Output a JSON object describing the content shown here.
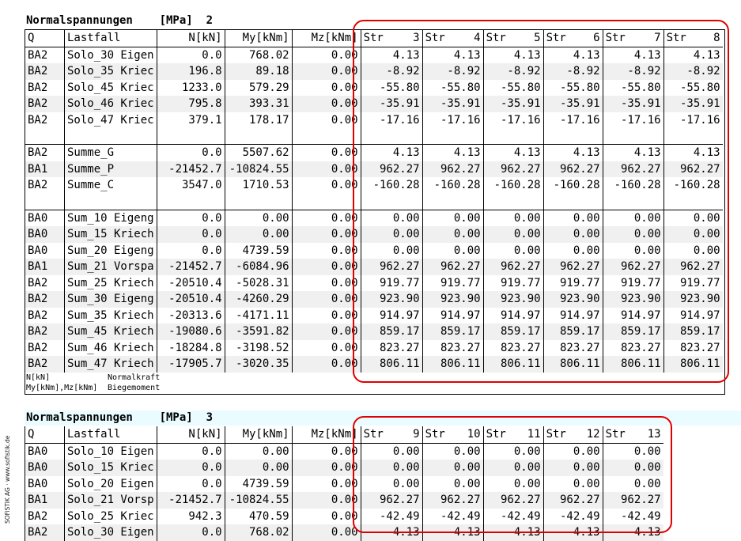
{
  "sidebar_text": "SOFiSTiK AG · www.sofistik.de",
  "section1": {
    "title": "Normalspannungen",
    "unit": "[MPa]",
    "number": "2",
    "columns": {
      "q": "Q",
      "lastfall": "Lastfall",
      "n": "N[kN]",
      "my": "My[kNm]",
      "mz": "Mz[kNm]",
      "str_label": "Str",
      "str_nums": [
        "3",
        "4",
        "5",
        "6",
        "7",
        "8"
      ]
    },
    "groups": [
      [
        {
          "q": "BA2",
          "lf": "Solo_30 Eigen",
          "n": "0.0",
          "my": "768.02",
          "mz": "0.00",
          "s": [
            "4.13",
            "4.13",
            "4.13",
            "4.13",
            "4.13",
            "4.13"
          ]
        },
        {
          "q": "BA2",
          "lf": "Solo_35 Kriec",
          "n": "196.8",
          "my": "89.18",
          "mz": "0.00",
          "s": [
            "-8.92",
            "-8.92",
            "-8.92",
            "-8.92",
            "-8.92",
            "-8.92"
          ]
        },
        {
          "q": "BA2",
          "lf": "Solo_45 Kriec",
          "n": "1233.0",
          "my": "579.29",
          "mz": "0.00",
          "s": [
            "-55.80",
            "-55.80",
            "-55.80",
            "-55.80",
            "-55.80",
            "-55.80"
          ]
        },
        {
          "q": "BA2",
          "lf": "Solo_46 Kriec",
          "n": "795.8",
          "my": "393.31",
          "mz": "0.00",
          "s": [
            "-35.91",
            "-35.91",
            "-35.91",
            "-35.91",
            "-35.91",
            "-35.91"
          ]
        },
        {
          "q": "BA2",
          "lf": "Solo_47 Kriec",
          "n": "379.1",
          "my": "178.17",
          "mz": "0.00",
          "s": [
            "-17.16",
            "-17.16",
            "-17.16",
            "-17.16",
            "-17.16",
            "-17.16"
          ]
        }
      ],
      [
        {
          "q": "BA2",
          "lf": "Summe_G",
          "n": "0.0",
          "my": "5507.62",
          "mz": "0.00",
          "s": [
            "4.13",
            "4.13",
            "4.13",
            "4.13",
            "4.13",
            "4.13"
          ]
        },
        {
          "q": "BA1",
          "lf": "Summe_P",
          "n": "-21452.7",
          "my": "-10824.55",
          "mz": "0.00",
          "s": [
            "962.27",
            "962.27",
            "962.27",
            "962.27",
            "962.27",
            "962.27"
          ]
        },
        {
          "q": "BA2",
          "lf": "Summe_C",
          "n": "3547.0",
          "my": "1710.53",
          "mz": "0.00",
          "s": [
            "-160.28",
            "-160.28",
            "-160.28",
            "-160.28",
            "-160.28",
            "-160.28"
          ]
        }
      ],
      [
        {
          "q": "BA0",
          "lf": "Sum_10 Eigeng",
          "n": "0.0",
          "my": "0.00",
          "mz": "0.00",
          "s": [
            "0.00",
            "0.00",
            "0.00",
            "0.00",
            "0.00",
            "0.00"
          ]
        },
        {
          "q": "BA0",
          "lf": "Sum_15 Kriech",
          "n": "0.0",
          "my": "0.00",
          "mz": "0.00",
          "s": [
            "0.00",
            "0.00",
            "0.00",
            "0.00",
            "0.00",
            "0.00"
          ]
        },
        {
          "q": "BA0",
          "lf": "Sum_20 Eigeng",
          "n": "0.0",
          "my": "4739.59",
          "mz": "0.00",
          "s": [
            "0.00",
            "0.00",
            "0.00",
            "0.00",
            "0.00",
            "0.00"
          ]
        },
        {
          "q": "BA1",
          "lf": "Sum_21 Vorspa",
          "n": "-21452.7",
          "my": "-6084.96",
          "mz": "0.00",
          "s": [
            "962.27",
            "962.27",
            "962.27",
            "962.27",
            "962.27",
            "962.27"
          ]
        },
        {
          "q": "BA2",
          "lf": "Sum_25 Kriech",
          "n": "-20510.4",
          "my": "-5028.31",
          "mz": "0.00",
          "s": [
            "919.77",
            "919.77",
            "919.77",
            "919.77",
            "919.77",
            "919.77"
          ]
        },
        {
          "q": "BA2",
          "lf": "Sum_30 Eigeng",
          "n": "-20510.4",
          "my": "-4260.29",
          "mz": "0.00",
          "s": [
            "923.90",
            "923.90",
            "923.90",
            "923.90",
            "923.90",
            "923.90"
          ]
        },
        {
          "q": "BA2",
          "lf": "Sum_35 Kriech",
          "n": "-20313.6",
          "my": "-4171.11",
          "mz": "0.00",
          "s": [
            "914.97",
            "914.97",
            "914.97",
            "914.97",
            "914.97",
            "914.97"
          ]
        },
        {
          "q": "BA2",
          "lf": "Sum_45 Kriech",
          "n": "-19080.6",
          "my": "-3591.82",
          "mz": "0.00",
          "s": [
            "859.17",
            "859.17",
            "859.17",
            "859.17",
            "859.17",
            "859.17"
          ]
        },
        {
          "q": "BA2",
          "lf": "Sum_46 Kriech",
          "n": "-18284.8",
          "my": "-3198.52",
          "mz": "0.00",
          "s": [
            "823.27",
            "823.27",
            "823.27",
            "823.27",
            "823.27",
            "823.27"
          ]
        },
        {
          "q": "BA2",
          "lf": "Sum_47 Kriech",
          "n": "-17905.7",
          "my": "-3020.35",
          "mz": "0.00",
          "s": [
            "806.11",
            "806.11",
            "806.11",
            "806.11",
            "806.11",
            "806.11"
          ]
        }
      ]
    ],
    "legend": [
      {
        "sym": "N[kN]",
        "desc": "Normalkraft"
      },
      {
        "sym": "My[kNm],Mz[kNm]",
        "desc": "Biegemoment"
      }
    ]
  },
  "section2": {
    "title": "Normalspannungen",
    "unit": "[MPa]",
    "number": "3",
    "columns": {
      "q": "Q",
      "lastfall": "Lastfall",
      "n": "N[kN]",
      "my": "My[kNm]",
      "mz": "Mz[kNm]",
      "str_label": "Str",
      "str_nums": [
        "9",
        "10",
        "11",
        "12",
        "13"
      ]
    },
    "rows": [
      {
        "q": "BA0",
        "lf": "Solo_10 Eigen",
        "n": "0.0",
        "my": "0.00",
        "mz": "0.00",
        "s": [
          "0.00",
          "0.00",
          "0.00",
          "0.00",
          "0.00"
        ]
      },
      {
        "q": "BA0",
        "lf": "Solo_15 Kriec",
        "n": "0.0",
        "my": "0.00",
        "mz": "0.00",
        "s": [
          "0.00",
          "0.00",
          "0.00",
          "0.00",
          "0.00"
        ]
      },
      {
        "q": "BA0",
        "lf": "Solo_20 Eigen",
        "n": "0.0",
        "my": "4739.59",
        "mz": "0.00",
        "s": [
          "0.00",
          "0.00",
          "0.00",
          "0.00",
          "0.00"
        ]
      },
      {
        "q": "BA1",
        "lf": "Solo_21 Vorsp",
        "n": "-21452.7",
        "my": "-10824.55",
        "mz": "0.00",
        "s": [
          "962.27",
          "962.27",
          "962.27",
          "962.27",
          "962.27"
        ]
      },
      {
        "q": "BA2",
        "lf": "Solo_25 Kriec",
        "n": "942.3",
        "my": "470.59",
        "mz": "0.00",
        "s": [
          "-42.49",
          "-42.49",
          "-42.49",
          "-42.49",
          "-42.49"
        ]
      },
      {
        "q": "BA2",
        "lf": "Solo_30 Eigen",
        "n": "0.0",
        "my": "768.02",
        "mz": "0.00",
        "s": [
          "4.13",
          "4.13",
          "4.13",
          "4.13",
          "4.13"
        ]
      }
    ]
  },
  "colors": {
    "highlight": "#e00000",
    "row_alt": "#f0f0f0",
    "title_band": "#eafcff"
  }
}
